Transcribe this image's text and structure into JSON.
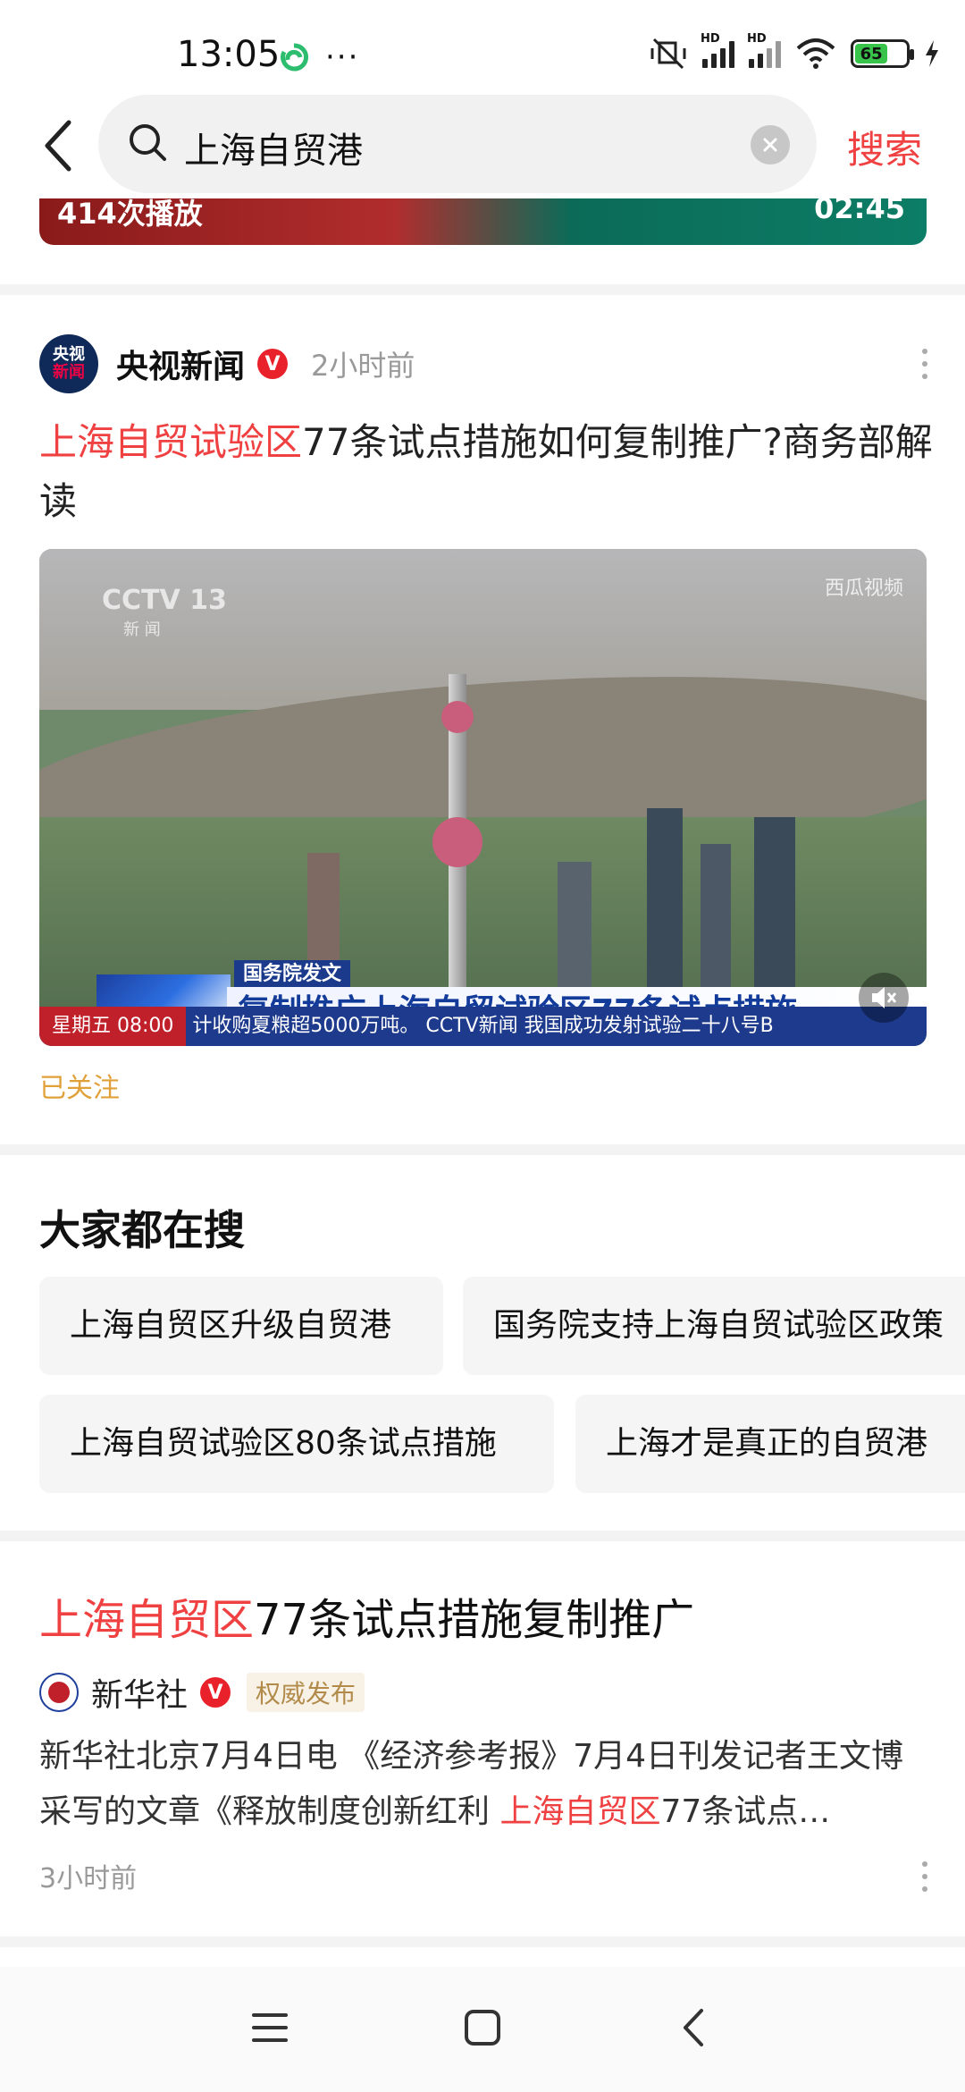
{
  "status_bar": {
    "time": "13:05",
    "more": "···",
    "battery_level": "65",
    "network_1": "HD",
    "network_2": "HD"
  },
  "search": {
    "query": "上海自贸港",
    "submit_label": "搜索"
  },
  "top_video": {
    "play_count": "414次播放",
    "duration": "02:45"
  },
  "post": {
    "avatar_line1": "央视",
    "avatar_line2": "新闻",
    "author": "央视新闻",
    "verified": "V",
    "time_ago": "2小时前",
    "title_highlight": "上海自贸试验区",
    "title_rest": "77条试点措施如何复制推广?商务部解读",
    "video": {
      "channel_logo": "CCTV 13",
      "channel_sub": "新 闻",
      "watermark": "西瓜视频",
      "tag": "国务院发文",
      "headline": "复制推广上海自贸试验区77条试点措施",
      "ticker_day": "星期五  08:00",
      "ticker_text": "计收购夏粮超5000万吨。   CCTV新闻   我国成功发射试验二十八号B"
    },
    "follow_status": "已关注"
  },
  "trending": {
    "title": "大家都在搜",
    "chips": [
      "上海自贸区升级自贸港",
      "国务院支持上海自贸试验区政策",
      "上海自贸试验区80条试点措施",
      "上海才是真正的自贸港"
    ]
  },
  "article": {
    "title_highlight": "上海自贸区",
    "title_rest": "77条试点措施复制推广",
    "source": "新华社",
    "verified": "V",
    "tag": "权威发布",
    "body_part1": "新华社北京7月4日电 《经济参考报》7月4日刊发记者王文博采写的文章《释放制度创新红利 ",
    "body_highlight": "上海自贸区",
    "body_part2": "77条试点…",
    "time_ago": "3小时前"
  },
  "icons": {
    "back": "chevron-left-icon",
    "search": "search-icon",
    "clear": "clear-icon",
    "more": "more-vertical-icon",
    "mute": "mute-icon",
    "nav_menu": "menu-icon",
    "nav_home": "home-icon",
    "nav_back": "back-icon"
  },
  "colors": {
    "accent": "#f04142",
    "followed": "#e0a13a",
    "verified": "#e8212a"
  }
}
